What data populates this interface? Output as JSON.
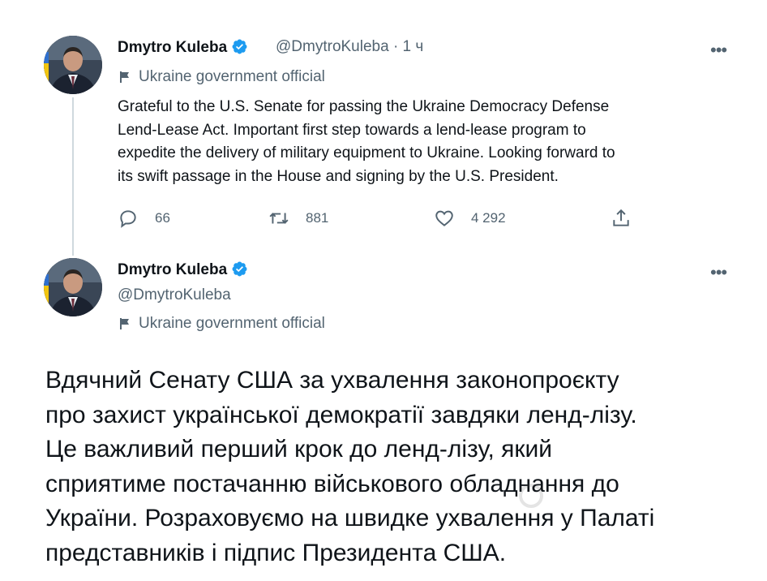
{
  "tweets": [
    {
      "author": {
        "name": "Dmytro Kuleba",
        "handle": "@DmytroKuleba",
        "time": "· 1 ч",
        "label": "Ukraine government official"
      },
      "text_lines": [
        "Grateful to the U.S. Senate for passing the Ukraine Democracy Defense",
        "Lend-Lease Act. Important first step towards a lend-lease program to",
        "expedite the delivery of military equipment to Ukraine. Looking forward to",
        "its swift passage in the House and signing by the U.S. President."
      ],
      "stats": {
        "replies": "66",
        "retweets": "881",
        "likes": "4 292"
      },
      "more_icon": "more-icon"
    },
    {
      "author": {
        "name": "Dmytro Kuleba",
        "handle": "@DmytroKuleba",
        "label": "Ukraine government official"
      },
      "text_lines": [
        "Вдячний Сенату США за ухвалення законопроєкту",
        "про захист української демократії завдяки ленд-лізу.",
        "Це важливий перший крок до ленд-лізу, який",
        "сприятиме постачанню військового обладнання до",
        "України. Розраховуємо на швидке ухвалення у Палаті",
        "представників і підпис Президента США."
      ],
      "more_icon": "more-icon"
    }
  ],
  "colors": {
    "verified": "#1d9bf0",
    "muted": "#536471",
    "text": "#0f1419",
    "thread_line": "#cfd9de"
  }
}
